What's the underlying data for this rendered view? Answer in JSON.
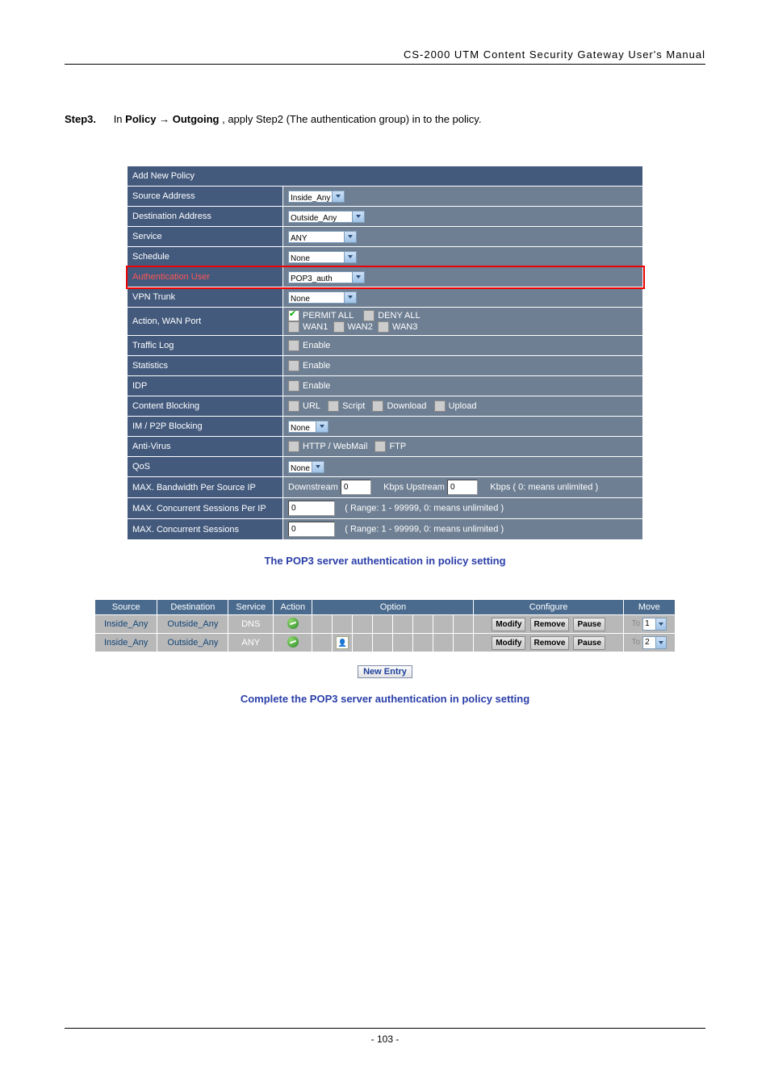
{
  "header": {
    "title": "CS-2000 UTM Content Security Gateway User's Manual"
  },
  "step": {
    "label": "Step3.",
    "prefix": "In ",
    "bold1": "Policy",
    "arrow": " → ",
    "bold2": "Outgoing",
    "suffix": ", apply Step2 (The authentication group) in to the policy."
  },
  "policy": {
    "title": "Add New Policy",
    "rows": {
      "source_address": {
        "label": "Source Address",
        "value": "Inside_Any"
      },
      "destination_address": {
        "label": "Destination Address",
        "value": "Outside_Any"
      },
      "service": {
        "label": "Service",
        "value": "ANY"
      },
      "schedule": {
        "label": "Schedule",
        "value": "None"
      },
      "authentication_user": {
        "label": "Authentication User",
        "value": "POP3_auth"
      },
      "vpn_trunk": {
        "label": "VPN Trunk",
        "value": "None"
      },
      "action_wan_port": {
        "label": "Action, WAN Port",
        "permit_label": "PERMIT ALL",
        "deny_label": "DENY ALL",
        "wan1": "WAN1",
        "wan2": "WAN2",
        "wan3": "WAN3"
      },
      "traffic_log": {
        "label": "Traffic Log",
        "value_label": "Enable"
      },
      "statistics": {
        "label": "Statistics",
        "value_label": "Enable"
      },
      "idp": {
        "label": "IDP",
        "value_label": "Enable"
      },
      "content_blocking": {
        "label": "Content Blocking",
        "url": "URL",
        "script": "Script",
        "download": "Download",
        "upload": "Upload"
      },
      "im_p2p": {
        "label": "IM / P2P Blocking",
        "value": "None"
      },
      "anti_virus": {
        "label": "Anti-Virus",
        "http": "HTTP / WebMail",
        "ftp": "FTP"
      },
      "qos": {
        "label": "QoS",
        "value": "None"
      },
      "max_bw_per_source_ip": {
        "label": "MAX. Bandwidth Per Source IP",
        "down_label": "Downstream",
        "down_val": "0",
        "up_label": "Kbps Upstream",
        "up_val": "0",
        "note": "Kbps ( 0: means unlimited )"
      },
      "max_conc_sessions_per_ip": {
        "label": "MAX. Concurrent Sessions Per IP",
        "value": "0",
        "note": "( Range: 1 - 99999, 0: means unlimited )"
      },
      "max_conc_sessions": {
        "label": "MAX. Concurrent Sessions",
        "value": "0",
        "note": "( Range: 1 - 99999, 0: means unlimited )"
      }
    }
  },
  "caption1": "The POP3 server authentication in policy setting",
  "list": {
    "headers": {
      "source": "Source",
      "destination": "Destination",
      "service": "Service",
      "action": "Action",
      "option": "Option",
      "configure": "Configure",
      "move": "Move"
    },
    "buttons": {
      "modify": "Modify",
      "remove": "Remove",
      "pause": "Pause"
    },
    "move_to": "To",
    "rows": [
      {
        "source": "Inside_Any",
        "destination": "Outside_Any",
        "service": "DNS",
        "move": "1"
      },
      {
        "source": "Inside_Any",
        "destination": "Outside_Any",
        "service": "ANY",
        "move": "2"
      }
    ],
    "new_entry": "New Entry"
  },
  "caption2": "Complete the POP3 server authentication in policy setting",
  "footer": {
    "page": "- 103 -"
  }
}
